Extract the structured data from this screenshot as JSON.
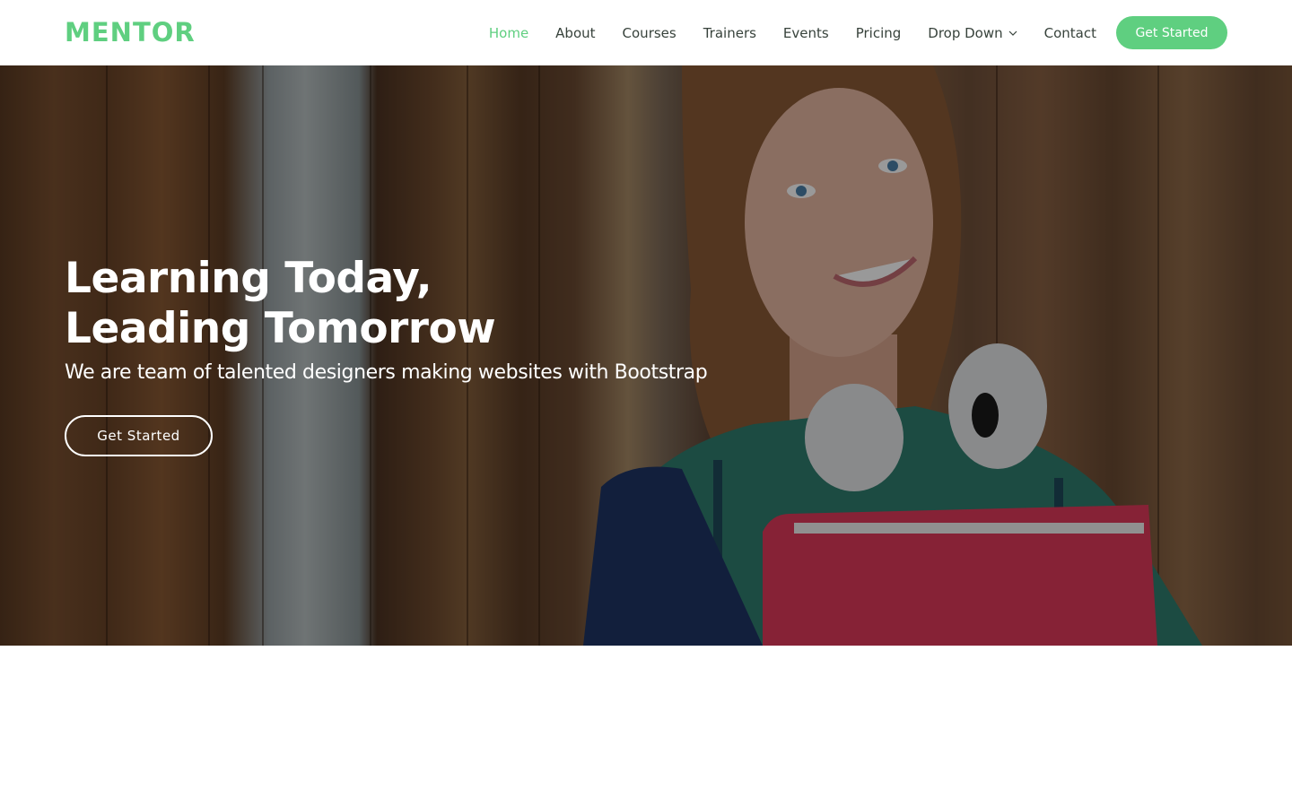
{
  "brand": {
    "logo": "MENTOR",
    "accent_color": "#5fcf80"
  },
  "nav": {
    "items": [
      {
        "label": "Home",
        "active": true
      },
      {
        "label": "About"
      },
      {
        "label": "Courses"
      },
      {
        "label": "Trainers"
      },
      {
        "label": "Events"
      },
      {
        "label": "Pricing"
      },
      {
        "label": "Drop Down",
        "icon": "chevron-down-icon"
      },
      {
        "label": "Contact"
      }
    ],
    "cta": "Get Started"
  },
  "hero": {
    "title_line1": "Learning Today,",
    "title_line2": "Leading Tomorrow",
    "subtitle": "We are team of talented designers making websites with Bootstrap",
    "button": "Get Started"
  }
}
